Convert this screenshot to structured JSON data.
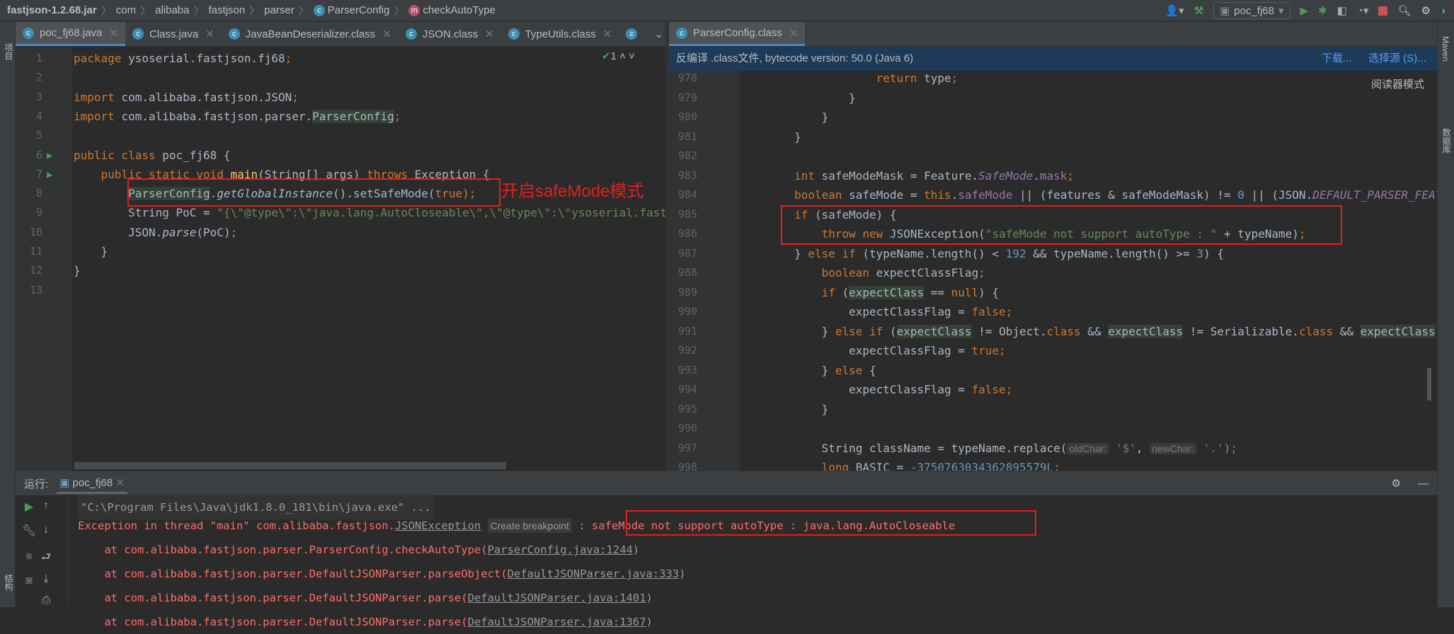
{
  "breadcrumb": [
    "fastjson-1.2.68.jar",
    "com",
    "alibaba",
    "fastjson",
    "parser",
    "ParserConfig",
    "checkAutoType"
  ],
  "run_config": "poc_fj68",
  "left_strip": {
    "project": "项目",
    "structure": "结构"
  },
  "right_strip": {
    "maven": "Maven",
    "database": "数据库"
  },
  "left_tabs": [
    "poc_fj68.java",
    "Class.java",
    "JavaBeanDeserializer.class",
    "JSON.class",
    "TypeUtils.class"
  ],
  "right_tabs": [
    "ParserConfig.class"
  ],
  "inspection": {
    "count": "1"
  },
  "banner": {
    "text": "反编译 .class文件, bytecode version: 50.0 (Java 6)",
    "download": "下载...",
    "choose_source": "选择源 (S)...",
    "reader_mode": "阅读器模式"
  },
  "annotation": "开启safeMode模式",
  "left_code": [
    {
      "n": "1",
      "t": [
        [
          "package",
          "kw"
        ],
        [
          " ysoserial.fastjson.fj68",
          ""
        ],
        [
          ";",
          "kw"
        ]
      ]
    },
    {
      "n": "2",
      "t": []
    },
    {
      "n": "3",
      "t": [
        [
          "import",
          "kw"
        ],
        [
          " com.alibaba.fastjson.JSON",
          ""
        ],
        [
          ";",
          "kw"
        ]
      ]
    },
    {
      "n": "4",
      "t": [
        [
          "import",
          "kw"
        ],
        [
          " com.alibaba.fastjson.parser.",
          ""
        ],
        [
          "ParserConfig",
          "hl"
        ],
        [
          ";",
          "kw"
        ]
      ]
    },
    {
      "n": "5",
      "t": []
    },
    {
      "n": "6",
      "t": [
        [
          "public class",
          "kw"
        ],
        [
          " poc_fj68 {",
          ""
        ]
      ]
    },
    {
      "n": "7",
      "t": [
        [
          "    public static void",
          "kw"
        ],
        [
          " ",
          ""
        ],
        [
          "main",
          "mth"
        ],
        [
          "(String[] args) ",
          ""
        ],
        [
          "throws",
          "kw"
        ],
        [
          " Exception {",
          ""
        ]
      ]
    },
    {
      "n": "8",
      "t": [
        [
          "        ",
          ""
        ],
        [
          "ParserConfig",
          "hl"
        ],
        [
          ".",
          ""
        ],
        [
          "getGlobalInstance",
          "ital"
        ],
        [
          "().setSafeMode(",
          ""
        ],
        [
          "true",
          "kw"
        ],
        [
          ");",
          "kw"
        ]
      ]
    },
    {
      "n": "9",
      "t": [
        [
          "        String PoC = ",
          ""
        ],
        [
          "\"{\\\"@type\\\":\\\"java.lang.AutoCloseable\\\",\\\"@type\\\":\\\"ysoserial.fastjson",
          "str"
        ]
      ]
    },
    {
      "n": "10",
      "t": [
        [
          "        JSON.",
          ""
        ],
        [
          "parse",
          "ital"
        ],
        [
          "(PoC)",
          ""
        ],
        [
          ";",
          "kw"
        ]
      ]
    },
    {
      "n": "11",
      "t": [
        [
          "    }",
          ""
        ]
      ]
    },
    {
      "n": "12",
      "t": [
        [
          "}",
          ""
        ]
      ]
    },
    {
      "n": "13",
      "t": []
    }
  ],
  "right_code": [
    {
      "n": "978",
      "t": [
        [
          "                    ",
          ""
        ],
        [
          "return",
          "kw"
        ],
        [
          " type",
          ""
        ],
        [
          ";",
          "kw"
        ]
      ]
    },
    {
      "n": "979",
      "t": [
        [
          "                }",
          ""
        ]
      ]
    },
    {
      "n": "980",
      "t": [
        [
          "            }",
          ""
        ]
      ]
    },
    {
      "n": "981",
      "t": [
        [
          "        }",
          ""
        ]
      ]
    },
    {
      "n": "982",
      "t": []
    },
    {
      "n": "983",
      "t": [
        [
          "        ",
          ""
        ],
        [
          "int",
          "kw"
        ],
        [
          " safeModeMask = Feature.",
          ""
        ],
        [
          "SafeMode",
          "fld ital"
        ],
        [
          ".",
          ""
        ],
        [
          "mask",
          "fld"
        ],
        [
          ";",
          "kw"
        ]
      ]
    },
    {
      "n": "984",
      "t": [
        [
          "        ",
          ""
        ],
        [
          "boolean",
          "kw"
        ],
        [
          " safeMode = ",
          ""
        ],
        [
          "this",
          "kw"
        ],
        [
          ".",
          ""
        ],
        [
          "safeMode",
          "fld"
        ],
        [
          " || (features & safeModeMask) != ",
          ""
        ],
        [
          "0",
          "num"
        ],
        [
          " || (JSON.",
          ""
        ],
        [
          "DEFAULT_PARSER_FEATURE",
          "fld ital"
        ]
      ]
    },
    {
      "n": "985",
      "t": [
        [
          "        ",
          ""
        ],
        [
          "if",
          "kw"
        ],
        [
          " (safeMode) {",
          ""
        ]
      ]
    },
    {
      "n": "986",
      "t": [
        [
          "            ",
          ""
        ],
        [
          "throw new",
          "kw"
        ],
        [
          " JSONException(",
          ""
        ],
        [
          "\"safeMode not support autoType : \"",
          "str"
        ],
        [
          " + typeName)",
          ""
        ],
        [
          ";",
          "kw"
        ]
      ]
    },
    {
      "n": "987",
      "t": [
        [
          "        } ",
          ""
        ],
        [
          "else if",
          "kw"
        ],
        [
          " (typeName.length() < ",
          ""
        ],
        [
          "192",
          "num"
        ],
        [
          " && typeName.length() >= ",
          ""
        ],
        [
          "3",
          "num"
        ],
        [
          ") {",
          ""
        ]
      ]
    },
    {
      "n": "988",
      "t": [
        [
          "            ",
          ""
        ],
        [
          "boolean",
          "kw"
        ],
        [
          " expectClassFlag",
          ""
        ],
        [
          ";",
          "kw"
        ]
      ]
    },
    {
      "n": "989",
      "t": [
        [
          "            ",
          ""
        ],
        [
          "if",
          "kw"
        ],
        [
          " (",
          ""
        ],
        [
          "expectClass",
          "hl"
        ],
        [
          " == ",
          ""
        ],
        [
          "null",
          "kw"
        ],
        [
          ") {",
          ""
        ]
      ]
    },
    {
      "n": "990",
      "t": [
        [
          "                expectClassFlag = ",
          ""
        ],
        [
          "false",
          "kw"
        ],
        [
          ";",
          "kw"
        ]
      ]
    },
    {
      "n": "991",
      "t": [
        [
          "            } ",
          ""
        ],
        [
          "else if",
          "kw"
        ],
        [
          " (",
          ""
        ],
        [
          "expectClass",
          "hl"
        ],
        [
          " != Object.",
          ""
        ],
        [
          "class",
          "kw"
        ],
        [
          " && ",
          ""
        ],
        [
          "expectClass",
          "hl"
        ],
        [
          " != Serializable.",
          ""
        ],
        [
          "class",
          "kw"
        ],
        [
          " && ",
          ""
        ],
        [
          "expectClass",
          "hl"
        ]
      ]
    },
    {
      "n": "992",
      "t": [
        [
          "                expectClassFlag = ",
          ""
        ],
        [
          "true",
          "kw"
        ],
        [
          ";",
          "kw"
        ]
      ]
    },
    {
      "n": "993",
      "t": [
        [
          "            } ",
          ""
        ],
        [
          "else",
          "kw"
        ],
        [
          " {",
          ""
        ]
      ]
    },
    {
      "n": "994",
      "t": [
        [
          "                expectClassFlag = ",
          ""
        ],
        [
          "false",
          "kw"
        ],
        [
          ";",
          "kw"
        ]
      ]
    },
    {
      "n": "995",
      "t": [
        [
          "            }",
          ""
        ]
      ]
    },
    {
      "n": "996",
      "t": []
    },
    {
      "n": "997",
      "t": [
        [
          "            String className = typeName.replace(",
          ""
        ],
        [
          "oldChar:",
          "hint"
        ],
        [
          " ",
          ""
        ],
        [
          "'$'",
          "str"
        ],
        [
          ", ",
          ""
        ],
        [
          "newChar:",
          "hint"
        ],
        [
          " ",
          ""
        ],
        [
          "'.'",
          "str"
        ],
        [
          ");",
          "kw"
        ]
      ]
    },
    {
      "n": "998",
      "t": [
        [
          "            ",
          ""
        ],
        [
          "long",
          "kw"
        ],
        [
          " BASIC = ",
          ""
        ],
        [
          "-3750763034362895579L",
          "num"
        ],
        [
          ";",
          "kw"
        ]
      ]
    }
  ],
  "run_panel": {
    "label": "运行:",
    "tab": "poc_fj68"
  },
  "console": {
    "cmd": "\"C:\\Program Files\\Java\\jdk1.8.0_181\\bin\\java.exe\" ...",
    "exception_prefix": "Exception in thread \"main\" com.alibaba.fastjson.",
    "exception_class": "JSONException",
    "create_breakpoint": "Create breakpoint",
    "exception_colon": " : ",
    "exception_message": "safeMode not support autoType : java.lang.AutoCloseable",
    "stack": [
      {
        "at": "    at com.alibaba.fastjson.parser.ParserConfig.checkAutoType(",
        "link": "ParserConfig.java:1244"
      },
      {
        "at": "    at com.alibaba.fastjson.parser.DefaultJSONParser.parseObject(",
        "link": "DefaultJSONParser.java:333"
      },
      {
        "at": "    at com.alibaba.fastjson.parser.DefaultJSONParser.parse(",
        "link": "DefaultJSONParser.java:1401"
      },
      {
        "at": "    at com.alibaba.fastjson.parser.DefaultJSONParser.parse(",
        "link": "DefaultJSONParser.java:1367"
      }
    ]
  }
}
